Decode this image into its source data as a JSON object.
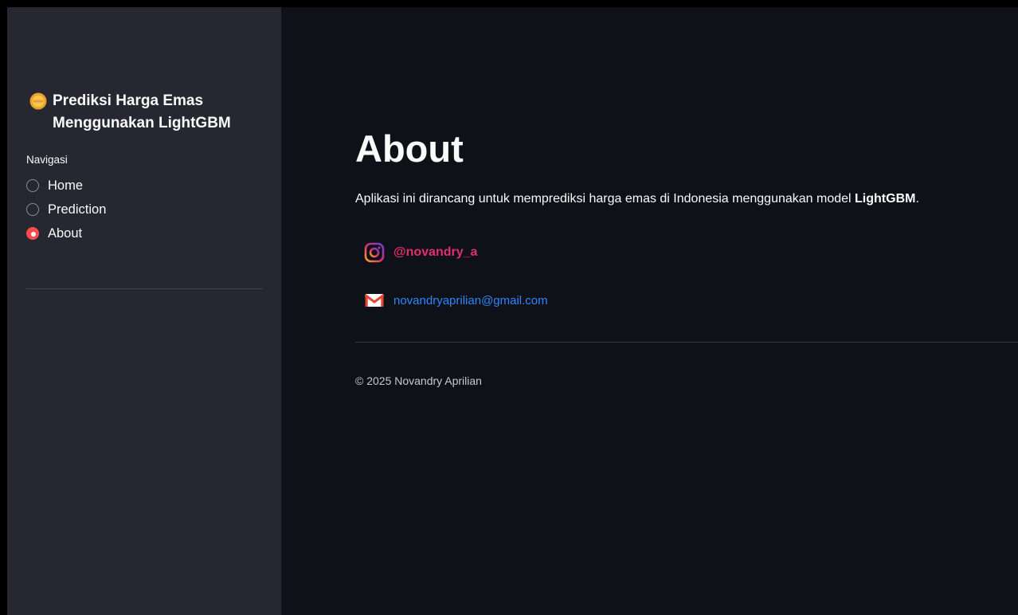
{
  "sidebar": {
    "title": "Prediksi Harga Emas Menggunakan LightGBM",
    "title_icon": "coin-icon",
    "nav_label": "Navigasi",
    "items": [
      {
        "label": "Home",
        "selected": false
      },
      {
        "label": "Prediction",
        "selected": false
      },
      {
        "label": "About",
        "selected": true
      }
    ]
  },
  "main": {
    "title": "About",
    "description_prefix": "Aplikasi ini dirancang untuk memprediksi harga emas di Indonesia menggunakan model ",
    "description_bold": "LightGBM",
    "description_suffix": ".",
    "contacts": {
      "instagram": {
        "icon": "instagram-icon",
        "label": "@novandry_a",
        "color": "#e1306c"
      },
      "email": {
        "icon": "gmail-icon",
        "label": "novandryaprilian@gmail.com",
        "color": "#2f86ff"
      }
    },
    "footer": "© 2025 Novandry Aprilian"
  },
  "colors": {
    "sidebar_bg": "#262730",
    "main_bg": "#0e1117",
    "accent": "#ff4b4b"
  }
}
